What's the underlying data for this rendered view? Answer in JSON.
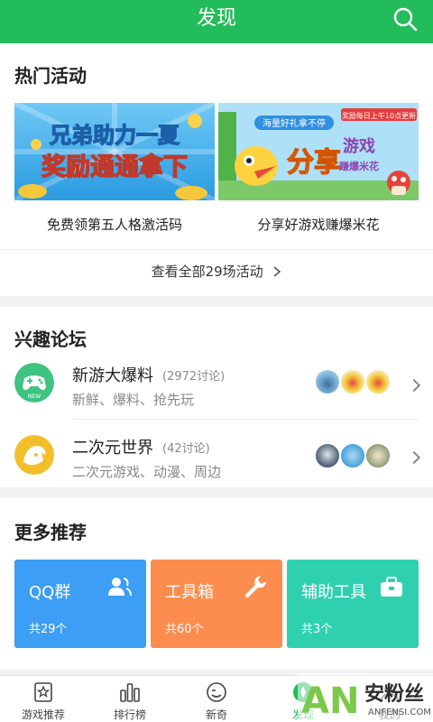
{
  "header": {
    "title": "发现",
    "icon": "search-icon"
  },
  "hot": {
    "title": "热门活动",
    "banners": [
      {
        "caption": "免费领第五人格激活码",
        "art_line1": "兄弟助力一夏",
        "art_line2": "奖励通通拿下"
      },
      {
        "caption": "分享好游戏赚爆米花",
        "art_main": "分享",
        "art_side1": "游戏",
        "art_side2": "赚爆米花",
        "art_tag": "海量好礼拿不停",
        "art_corner": "奖励每日上午10点更新"
      }
    ],
    "view_all": "查看全部29场活动"
  },
  "forum": {
    "title": "兴趣论坛",
    "items": [
      {
        "name": "新游大爆料",
        "count": "(2972讨论)",
        "sub": "新鲜、爆料、抢先玩",
        "icon": "gamepad-icon",
        "color": "#3fc380",
        "icon_label": "NEW"
      },
      {
        "name": "二次元世界",
        "count": "(42讨论)",
        "sub": "二次元游戏、动漫、周边",
        "icon": "anime-character-icon",
        "color": "#f2bf2b"
      }
    ]
  },
  "more": {
    "title": "更多推荐",
    "cards": [
      {
        "name": "QQ群",
        "count": "共29个",
        "color": "#3c9ef5",
        "icon": "group-icon"
      },
      {
        "name": "工具箱",
        "count": "共60个",
        "color": "#fd8d4f",
        "icon": "wrench-icon"
      },
      {
        "name": "辅助工具",
        "count": "共3个",
        "color": "#2fd0b0",
        "icon": "toolbox-icon"
      }
    ]
  },
  "nav": {
    "tabs": [
      {
        "label": "游戏推荐",
        "icon": "star-doc-icon"
      },
      {
        "label": "排行榜",
        "icon": "bars-icon"
      },
      {
        "label": "新奇",
        "icon": "face-icon"
      },
      {
        "label": "发现",
        "icon": "compass-icon",
        "active": true
      },
      {
        "label": "我的",
        "icon": "person-icon"
      }
    ]
  },
  "watermark": {
    "letters": "AN",
    "text": "安粉丝",
    "url": "ANFENSI.COM"
  }
}
